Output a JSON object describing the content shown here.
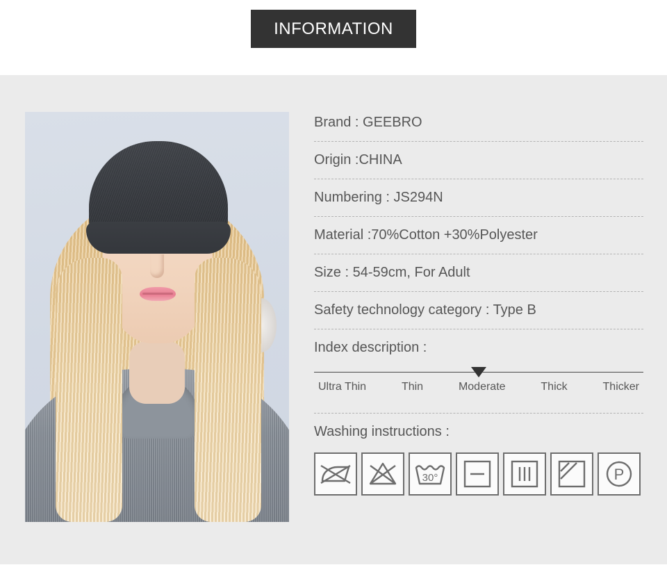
{
  "header": {
    "badge_label": "INFORMATION"
  },
  "product_photo": {
    "alt": "woman wearing dark gray knit beanie hat"
  },
  "specs": [
    {
      "label": "Brand",
      "text": "Brand : GEEBRO"
    },
    {
      "label": "Origin",
      "text": "Origin :CHINA"
    },
    {
      "label": "Numbering",
      "text": "Numbering : JS294N"
    },
    {
      "label": "Material",
      "text": "Material :70%Cotton +30%Polyester"
    },
    {
      "label": "Size",
      "text": "Size : 54-59cm, For Adult"
    },
    {
      "label": "Safety",
      "text": "Safety technology category : Type B"
    }
  ],
  "index_description": {
    "title": "Index description :",
    "levels": [
      "Ultra Thin",
      "Thin",
      "Moderate",
      "Thick",
      "Thicker"
    ],
    "selected": "Moderate",
    "selected_index": 2,
    "marker_position_percent": 50
  },
  "washing": {
    "title": "Washing instructions :",
    "icons": [
      {
        "name": "do-not-wring-icon",
        "label": "Do not wring"
      },
      {
        "name": "do-not-bleach-icon",
        "label": "Do not bleach"
      },
      {
        "name": "wash-30-degrees-icon",
        "label": "Wash at 30°",
        "temperature": "30°"
      },
      {
        "name": "dry-flat-icon",
        "label": "Dry flat"
      },
      {
        "name": "drip-dry-icon",
        "label": "Drip dry"
      },
      {
        "name": "dry-in-shade-icon",
        "label": "Dry in shade"
      },
      {
        "name": "professional-dry-clean-p-icon",
        "label": "Professional dry clean",
        "symbol": "P"
      }
    ]
  },
  "colors": {
    "header_badge_bg": "#333333",
    "header_badge_text": "#ffffff",
    "panel_bg": "#ebebeb",
    "page_bg": "#ffffff",
    "text": "#565656",
    "divider": "#b3b3b3",
    "icon_stroke": "#6d6d6d",
    "scale_line": "#4a4a4a"
  }
}
